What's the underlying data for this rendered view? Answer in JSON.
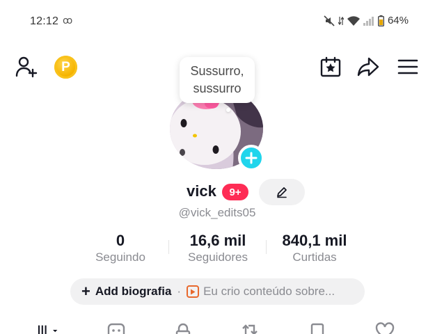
{
  "status_bar": {
    "time": "12:12",
    "voicemail_glyph": "ꝏ",
    "battery": "64%",
    "icons": [
      "mute-icon",
      "data-arrows-icon",
      "wifi-icon",
      "signal-icon",
      "battery-icon"
    ]
  },
  "top_bar": {
    "coin_letter": "P",
    "icons": [
      "add-friend-icon",
      "coin-icon",
      "calendar-star-icon",
      "share-icon",
      "menu-icon"
    ]
  },
  "bubble": {
    "line1": "Sussurro,",
    "line2": "sussurro"
  },
  "profile": {
    "username": "vick",
    "notification_badge": "9+",
    "handle": "@vick_edits05"
  },
  "stats": {
    "following": {
      "value": "0",
      "label": "Seguindo"
    },
    "followers": {
      "value": "16,6 mil",
      "label": "Seguidores"
    },
    "likes": {
      "value": "840,1 mil",
      "label": "Curtidas"
    }
  },
  "bio": {
    "add_label": "Add biografia",
    "separator": "·",
    "promo_text": "Eu crio conteúdo sobre..."
  },
  "tabs": [
    "videos-grid-icon",
    "private-icon",
    "lock-icon",
    "repost-icon",
    "saved-icon",
    "liked-icon"
  ],
  "colors": {
    "accent_pink": "#fe2c55",
    "accent_cyan": "#20d5ec",
    "coin_gold": "#f6b400",
    "promo_orange": "#e8692d"
  }
}
